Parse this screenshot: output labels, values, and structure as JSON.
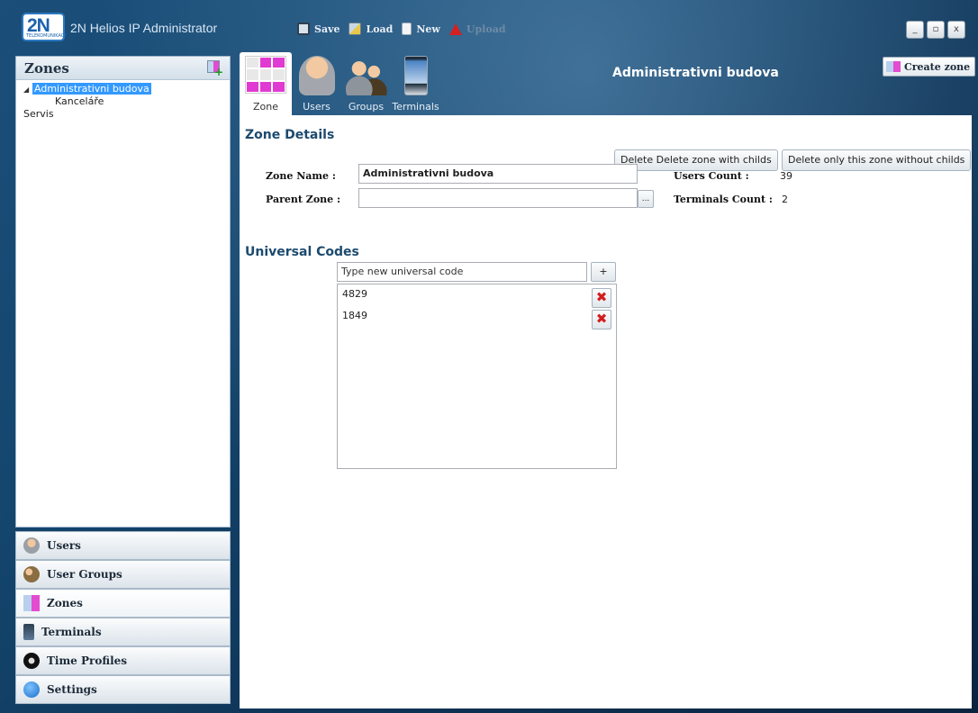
{
  "app": {
    "logo_text": "2N",
    "logo_subtext": "TELEKOMUNIKACE",
    "title": "2N Helios IP Administrator"
  },
  "toolbar": {
    "save_label": "Save",
    "load_label": "Load",
    "new_label": "New",
    "upload_label": "Upload"
  },
  "window_controls": {
    "minimize": "_",
    "maximize": "▫",
    "close": "x"
  },
  "zones_panel": {
    "title": "Zones",
    "tree": [
      {
        "label": "Administrativni budova",
        "level": 0,
        "selected": true,
        "expanded": true
      },
      {
        "label": "Kanceláře",
        "level": 1,
        "selected": false
      },
      {
        "label": "Servis",
        "level": -1,
        "selected": false
      }
    ]
  },
  "nav": {
    "items": [
      {
        "label": "Users",
        "icon": "user-icon"
      },
      {
        "label": "User Groups",
        "icon": "user-groups-icon"
      },
      {
        "label": "Zones",
        "icon": "zones-icon",
        "active": true
      },
      {
        "label": "Terminals",
        "icon": "terminal-icon"
      },
      {
        "label": "Time Profiles",
        "icon": "clock-icon"
      },
      {
        "label": "Settings",
        "icon": "info-icon"
      }
    ]
  },
  "tabs": [
    {
      "label": "Zone",
      "active": true
    },
    {
      "label": "Users"
    },
    {
      "label": "Groups"
    },
    {
      "label": "Terminals"
    }
  ],
  "header": {
    "zone_name": "Administrativni budova",
    "create_zone_label": "Create zone"
  },
  "zone_details": {
    "title": "Zone Details",
    "delete_with_childs_label": "Delete Delete zone with childs",
    "delete_only_label": "Delete only this zone without childs",
    "zone_name_label": "Zone Name :",
    "zone_name_value": "Administrativni budova",
    "parent_zone_label": "Parent Zone :",
    "parent_zone_value": "",
    "browse_label": "...",
    "users_count_label": "Users Count :",
    "users_count_value": "39",
    "terminals_count_label": "Terminals Count :",
    "terminals_count_value": "2"
  },
  "universal_codes": {
    "title": "Universal Codes",
    "input_placeholder": "Type new universal code",
    "add_label": "+",
    "codes": [
      "4829",
      "1849"
    ],
    "delete_glyph": "✖"
  }
}
